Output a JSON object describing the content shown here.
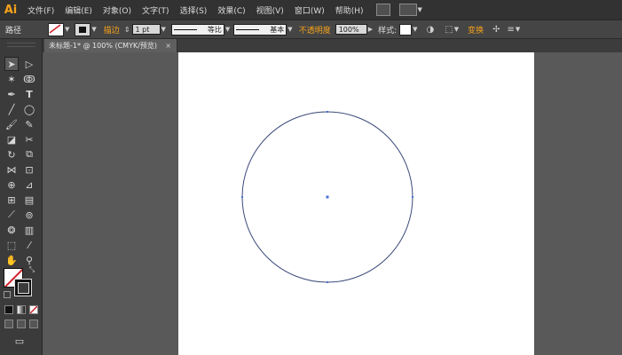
{
  "app": {
    "logo": "Ai"
  },
  "menubar": {
    "items": [
      "文件(F)",
      "编辑(E)",
      "对象(O)",
      "文字(T)",
      "选择(S)",
      "效果(C)",
      "视图(V)",
      "窗口(W)",
      "帮助(H)"
    ],
    "bridge_icon": "bridge-icon",
    "workspace_icon": "arrange-documents-icon"
  },
  "control_bar": {
    "selection_label": "路径",
    "stroke_label": "描边",
    "stroke_weight": "1 pt",
    "profile_label": "等比",
    "brush_label": "基本",
    "opacity_label": "不透明度",
    "opacity_value": "100%",
    "style_label": "样式:",
    "transform_label": "变换",
    "accent_color": "#f7a21a"
  },
  "document": {
    "tab_title": "未标题-1* @ 100% (CMYK/预览)",
    "close_glyph": "×"
  },
  "toolbox": {
    "tools": [
      "selection-tool",
      "direct-selection-tool",
      "magic-wand-tool",
      "lasso-tool",
      "pen-tool",
      "type-tool",
      "line-segment-tool",
      "ellipse-tool",
      "paintbrush-tool",
      "pencil-tool",
      "blob-brush-tool",
      "eraser-tool",
      "rotate-tool",
      "scale-tool",
      "width-tool",
      "free-transform-tool",
      "shape-builder-tool",
      "perspective-grid-tool",
      "mesh-tool",
      "gradient-tool",
      "eyedropper-tool",
      "blend-tool",
      "symbol-sprayer-tool",
      "column-graph-tool",
      "artboard-tool",
      "slice-tool",
      "hand-tool",
      "zoom-tool"
    ],
    "fill": "none",
    "stroke": "#111111"
  },
  "canvas": {
    "shape": "circle",
    "stroke_color": "#3c4a7a"
  }
}
